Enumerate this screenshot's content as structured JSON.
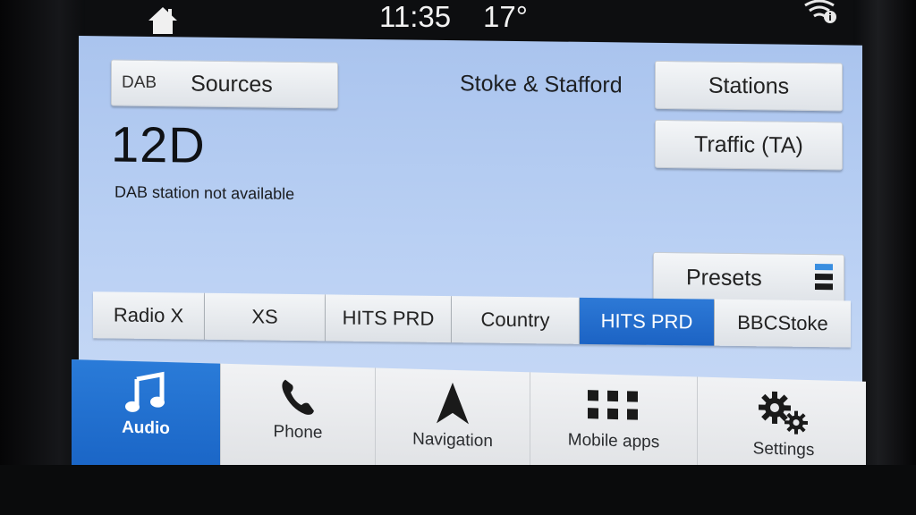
{
  "status_bar": {
    "time": "11:35",
    "temperature": "17°"
  },
  "header": {
    "band": "DAB",
    "sources_label": "Sources",
    "region": "Stoke & Stafford",
    "stations_label": "Stations",
    "traffic_label": "Traffic (TA)"
  },
  "station": {
    "frequency": "12D",
    "status": "DAB station not available"
  },
  "presets_label": "Presets",
  "presets": [
    "Radio X",
    "XS",
    "HITS PRD",
    "Country",
    "HITS PRD",
    "BBCStoke"
  ],
  "active_preset_index": 4,
  "nav": {
    "audio": "Audio",
    "phone": "Phone",
    "navigation": "Navigation",
    "mobile_apps": "Mobile apps",
    "settings": "Settings"
  },
  "colors": {
    "accent_blue": "#1f6bcc",
    "screen_bg": "#b4ccf2"
  }
}
